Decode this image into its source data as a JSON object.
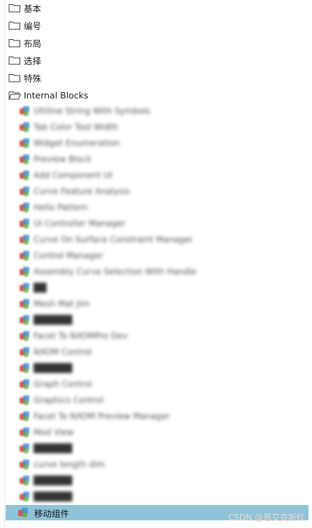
{
  "folders": [
    {
      "label": "基本",
      "state": "closed"
    },
    {
      "label": "编号",
      "state": "closed"
    },
    {
      "label": "布局",
      "state": "closed"
    },
    {
      "label": "选择",
      "state": "closed"
    },
    {
      "label": "特殊",
      "state": "closed"
    },
    {
      "label": "Internal Blocks",
      "state": "open"
    }
  ],
  "internal_blocks": [
    {
      "label": "Ultiline String With Symbols"
    },
    {
      "label": "Tab Color Tool Width"
    },
    {
      "label": "Widget Enumeration"
    },
    {
      "label": "Preview Block"
    },
    {
      "label": "Add Component UI"
    },
    {
      "label": "Curve Feature Analysis"
    },
    {
      "label": "Hello Pattern"
    },
    {
      "label": "UI Controller Manager"
    },
    {
      "label": "Curve On Surface Constraint Manager"
    },
    {
      "label": "Control Manager"
    },
    {
      "label": "Assembly Curve Selection With Handle"
    },
    {
      "label": "██",
      "bold": true
    },
    {
      "label": "Mesh Mat Jim"
    },
    {
      "label": "██████",
      "bold": true
    },
    {
      "label": "Facet To NXOMPro Dev"
    },
    {
      "label": "NXOM Control"
    },
    {
      "label": "██████",
      "bold": true
    },
    {
      "label": "Graph Control"
    },
    {
      "label": "Graphics Control"
    },
    {
      "label": "Facet To NXOM Preview Manager"
    },
    {
      "label": "Mod View"
    },
    {
      "label": "██████",
      "bold": true
    },
    {
      "label": "curve length dim"
    },
    {
      "label": "██████",
      "bold": true
    },
    {
      "label": "██████",
      "bold": true
    }
  ],
  "selected_item": {
    "label": "移动组件"
  },
  "watermark": "CSDN @恩艾克斯红",
  "colors": {
    "selection_bg": "#8fc4d8",
    "icon_red": "#d9544f",
    "icon_blue": "#3f8fd4",
    "icon_green": "#6cb24a"
  }
}
